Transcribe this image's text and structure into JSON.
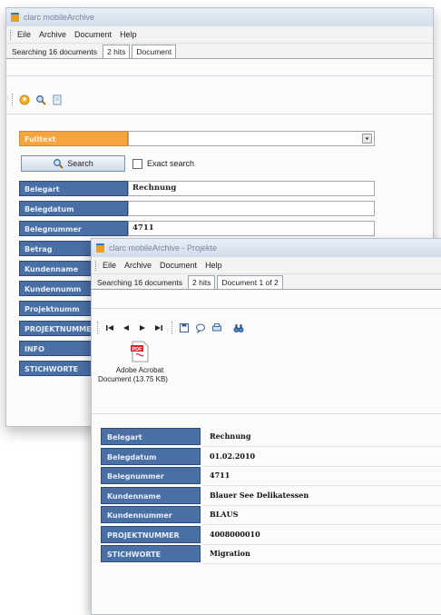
{
  "back_window": {
    "title": "clarc mobileArchive",
    "menu": [
      "Eile",
      "Archive",
      "Document",
      "Help"
    ],
    "tabs": [
      "Searching 16 documents",
      "2 hits",
      "Document"
    ],
    "fulltext_label": "Fulltext",
    "search_label": "Search",
    "exact_search_label": "Exact search",
    "fields": [
      {
        "label": "Belegart",
        "value": "Rechnung"
      },
      {
        "label": "Belegdatum",
        "value": ""
      },
      {
        "label": "Belegnummer",
        "value": "4711"
      },
      {
        "label": "Betrag",
        "value": ""
      },
      {
        "label": "Kundenname",
        "value": ""
      },
      {
        "label": "Kundennumm",
        "value": ""
      },
      {
        "label": "Projektnumm",
        "value": ""
      },
      {
        "label": "PROJEKTNUMME",
        "value": ""
      },
      {
        "label": "INFO",
        "value": ""
      },
      {
        "label": "STICHWORTE",
        "value": ""
      }
    ]
  },
  "front_window": {
    "title": "clarc mobileArchive - Projekte",
    "menu": [
      "Eile",
      "Archive",
      "Document",
      "Help"
    ],
    "tabs": [
      "Searching 16 documents",
      "2 hits",
      "Document 1 of 2"
    ],
    "attachment": {
      "line1": "Adobe Acrobat",
      "line2": "Document (13.75 KB)"
    },
    "fields": [
      {
        "label": "Belegart",
        "value": "Rechnung"
      },
      {
        "label": "Belegdatum",
        "value": "01.02.2010"
      },
      {
        "label": "Belegnummer",
        "value": "4711"
      },
      {
        "label": "Kundenname",
        "value": "Blauer See Delikatessen"
      },
      {
        "label": "Kundennummer",
        "value": "BLAUS"
      },
      {
        "label": "PROJEKTNUMMER",
        "value": "4008000010"
      },
      {
        "label": "STICHWORTE",
        "value": "Migration"
      }
    ]
  },
  "colors": {
    "field_label": "#4a6fa5",
    "fulltext_label": "#f5a43e",
    "title_bar": "#d2dceb"
  },
  "icons": [
    "app-icon",
    "user-icon",
    "search-icon",
    "document-icon",
    "first-icon",
    "prev-icon",
    "next-icon",
    "last-icon",
    "save-icon",
    "comment-icon",
    "print-icon",
    "binoculars-icon",
    "pdf-icon"
  ]
}
